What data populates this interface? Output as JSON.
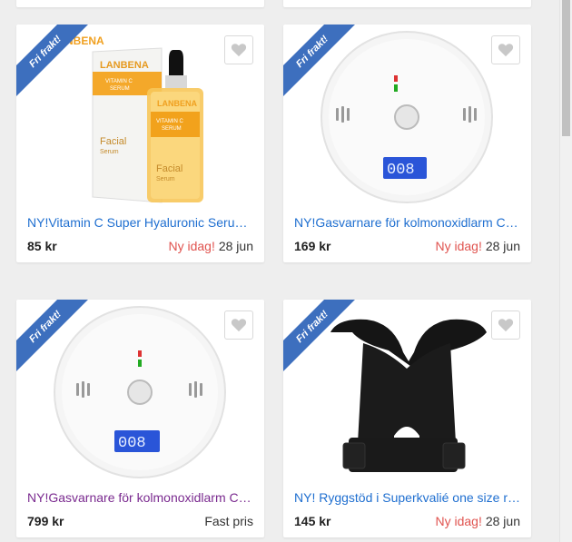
{
  "ribbon_text": "Fri frakt!",
  "cards": [
    {
      "title": "NY!Vitamin C Super Hyaluronic Serum LANBENA",
      "price": "85 kr",
      "badge": "Ny idag!",
      "date": "28 jun",
      "image": "serum-bottle",
      "product": {
        "brand": "LANBENA",
        "line1": "VITAMIN C",
        "line2": "SERUM",
        "label": "Facial",
        "sub": "Serum"
      }
    },
    {
      "title": "NY!Gasvarnare för kolmonoxidlarm CO-detektor",
      "price": "169 kr",
      "badge": "Ny idag!",
      "date": "28 jun",
      "image": "co-detector",
      "display": "008"
    },
    {
      "title": "NY!Gasvarnare för kolmonoxidlarm CO-detektor",
      "price": "799 kr",
      "badge": "",
      "date": "Fast pris",
      "image": "co-detector",
      "display": "008"
    },
    {
      "title": "NY! Ryggstöd i Superkvalié one size rygg",
      "price": "145 kr",
      "badge": "Ny idag!",
      "date": "28 jun",
      "image": "posture-brace"
    }
  ],
  "colors": {
    "accent": "#1f6fd0",
    "ribbon": "#3d6fbe",
    "new": "#e0534f",
    "visited": "#7a2a8f"
  }
}
